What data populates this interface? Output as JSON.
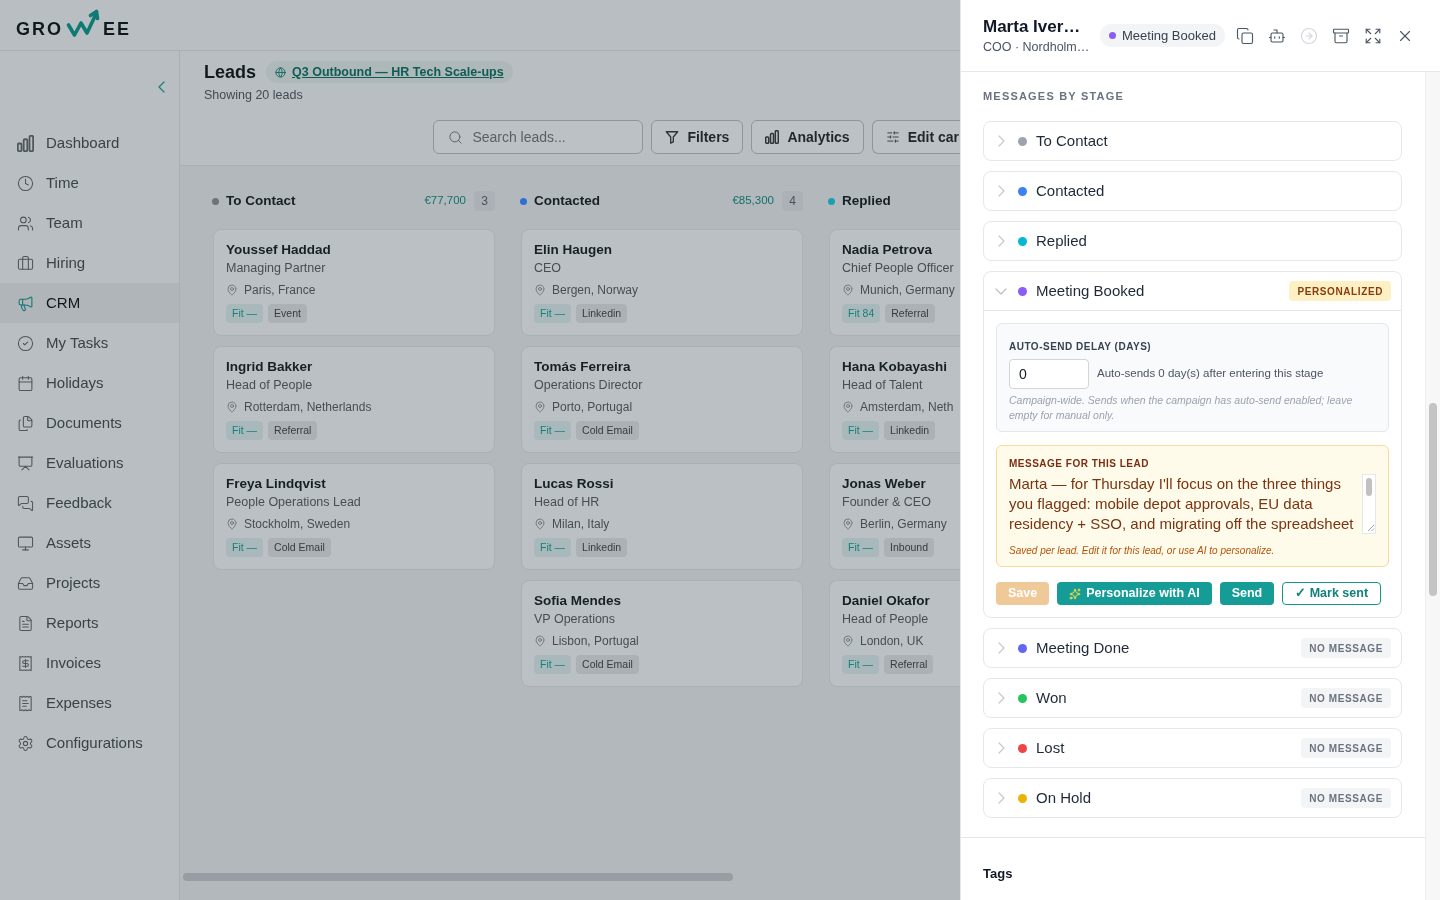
{
  "logo": {
    "text_start": "GRO",
    "text_end": "EE"
  },
  "sidebar": {
    "items": [
      {
        "label": "Dashboard",
        "selected": false
      },
      {
        "label": "Time",
        "selected": false
      },
      {
        "label": "Team",
        "selected": false
      },
      {
        "label": "Hiring",
        "selected": false
      },
      {
        "label": "CRM",
        "selected": true
      },
      {
        "label": "My Tasks",
        "selected": false
      },
      {
        "label": "Holidays",
        "selected": false
      },
      {
        "label": "Documents",
        "selected": false
      },
      {
        "label": "Evaluations",
        "selected": false
      },
      {
        "label": "Feedback",
        "selected": false
      },
      {
        "label": "Assets",
        "selected": false
      },
      {
        "label": "Projects",
        "selected": false
      },
      {
        "label": "Reports",
        "selected": false
      },
      {
        "label": "Invoices",
        "selected": false
      },
      {
        "label": "Expenses",
        "selected": false
      },
      {
        "label": "Configurations",
        "selected": false
      }
    ]
  },
  "header": {
    "title": "Leads",
    "campaign": "Q3 Outbound — HR Tech Scale-ups",
    "subtitle": "Showing 20 leads"
  },
  "toolbar": {
    "search": {
      "placeholder": "Search leads..."
    },
    "buttons": [
      "Filters",
      "Analytics",
      "Edit car"
    ]
  },
  "columns": [
    {
      "title": "To Contact",
      "color": "#6e737b",
      "amount": "€77,700",
      "count": "3",
      "cards": [
        {
          "name": "Youssef Haddad",
          "role": "Managing Partner",
          "location": "Paris, France",
          "fit": "Fit —",
          "source": "Event"
        },
        {
          "name": "Ingrid Bakker",
          "role": "Head of People",
          "location": "Rotterdam, Netherlands",
          "fit": "Fit —",
          "source": "Referral"
        },
        {
          "name": "Freya Lindqvist",
          "role": "People Operations Lead",
          "location": "Stockholm, Sweden",
          "fit": "Fit —",
          "source": "Cold Email"
        }
      ]
    },
    {
      "title": "Contacted",
      "color": "#2f6fd0",
      "amount": "€85,300",
      "count": "4",
      "cards": [
        {
          "name": "Elin Haugen",
          "role": "CEO",
          "location": "Bergen, Norway",
          "fit": "Fit —",
          "source": "Linkedin"
        },
        {
          "name": "Tomás Ferreira",
          "role": "Operations Director",
          "location": "Porto, Portugal",
          "fit": "Fit —",
          "source": "Cold Email"
        },
        {
          "name": "Lucas Rossi",
          "role": "Head of HR",
          "location": "Milan, Italy",
          "fit": "Fit —",
          "source": "Linkedin"
        },
        {
          "name": "Sofia Mendes",
          "role": "VP Operations",
          "location": "Lisbon, Portugal",
          "fit": "Fit —",
          "source": "Cold Email"
        }
      ]
    },
    {
      "title": "Replied",
      "color": "#1a9fb0",
      "cards": [
        {
          "name": "Nadia Petrova",
          "role": "Chief People Officer",
          "location": "Munich, Germany",
          "fit": "Fit 84",
          "source": "Referral"
        },
        {
          "name": "Hana Kobayashi",
          "role": "Head of Talent",
          "location": "Amsterdam, Neth",
          "fit": "Fit —",
          "source": "Linkedin"
        },
        {
          "name": "Jonas Weber",
          "role": "Founder & CEO",
          "location": "Berlin, Germany",
          "fit": "Fit —",
          "source": "Inbound"
        },
        {
          "name": "Daniel Okafor",
          "role": "Head of People",
          "location": "London, UK",
          "fit": "Fit —",
          "source": "Referral"
        }
      ]
    }
  ],
  "panel": {
    "name": "Marta Iver…",
    "subtitle": "COO · Nordholm…",
    "status": {
      "label": "Meeting Booked",
      "color": "#8b5cf6"
    },
    "header_actions": [
      {
        "disabled": false
      },
      {
        "disabled": false
      },
      {
        "disabled": true
      },
      {
        "disabled": false
      },
      {
        "disabled": false
      },
      {
        "disabled": false
      }
    ],
    "section_title": "MESSAGES BY STAGE",
    "stages": [
      {
        "label": "To Contact",
        "color": "#9ca3af",
        "expanded": false
      },
      {
        "label": "Contacted",
        "color": "#3b82f6",
        "expanded": false
      },
      {
        "label": "Replied",
        "color": "#06b6d4",
        "expanded": false
      },
      {
        "label": "Meeting Booked",
        "color": "#8b5cf6",
        "expanded": true,
        "badge": {
          "label": "PERSONALIZED",
          "kind": "personalized"
        },
        "detail": {
          "delay": {
            "label": "AUTO-SEND DELAY (DAYS)",
            "value": "0",
            "note": "Auto-sends 0 day(s) after entering this stage",
            "help": "Campaign-wide. Sends when the campaign has auto-send enabled; leave empty for manual only."
          },
          "message": {
            "label": "MESSAGE FOR THIS LEAD",
            "value": "Marta — for Thursday I'll focus on the three things you flagged: mobile depot approvals, EU data residency + SSO, and migrating off the spreadsheet",
            "help": "Saved per lead. Edit it for this lead, or use AI to personalize."
          },
          "actions": [
            {
              "label": "Save",
              "kind": "save",
              "disabled": true
            },
            {
              "label": "Personalize with AI",
              "kind": "ai",
              "disabled": false
            },
            {
              "label": "Send",
              "kind": "send",
              "disabled": false
            },
            {
              "label": "✓ Mark sent",
              "kind": "outline",
              "disabled": false
            }
          ]
        }
      },
      {
        "label": "Meeting Done",
        "color": "#6366f1",
        "expanded": false,
        "badge": {
          "label": "NO MESSAGE",
          "kind": "empty"
        }
      },
      {
        "label": "Won",
        "color": "#22c55e",
        "expanded": false,
        "badge": {
          "label": "NO MESSAGE",
          "kind": "empty"
        }
      },
      {
        "label": "Lost",
        "color": "#ef4444",
        "expanded": false,
        "badge": {
          "label": "NO MESSAGE",
          "kind": "empty"
        }
      },
      {
        "label": "On Hold",
        "color": "#eab308",
        "expanded": false,
        "badge": {
          "label": "NO MESSAGE",
          "kind": "empty"
        }
      }
    ],
    "tags_title": "Tags"
  }
}
